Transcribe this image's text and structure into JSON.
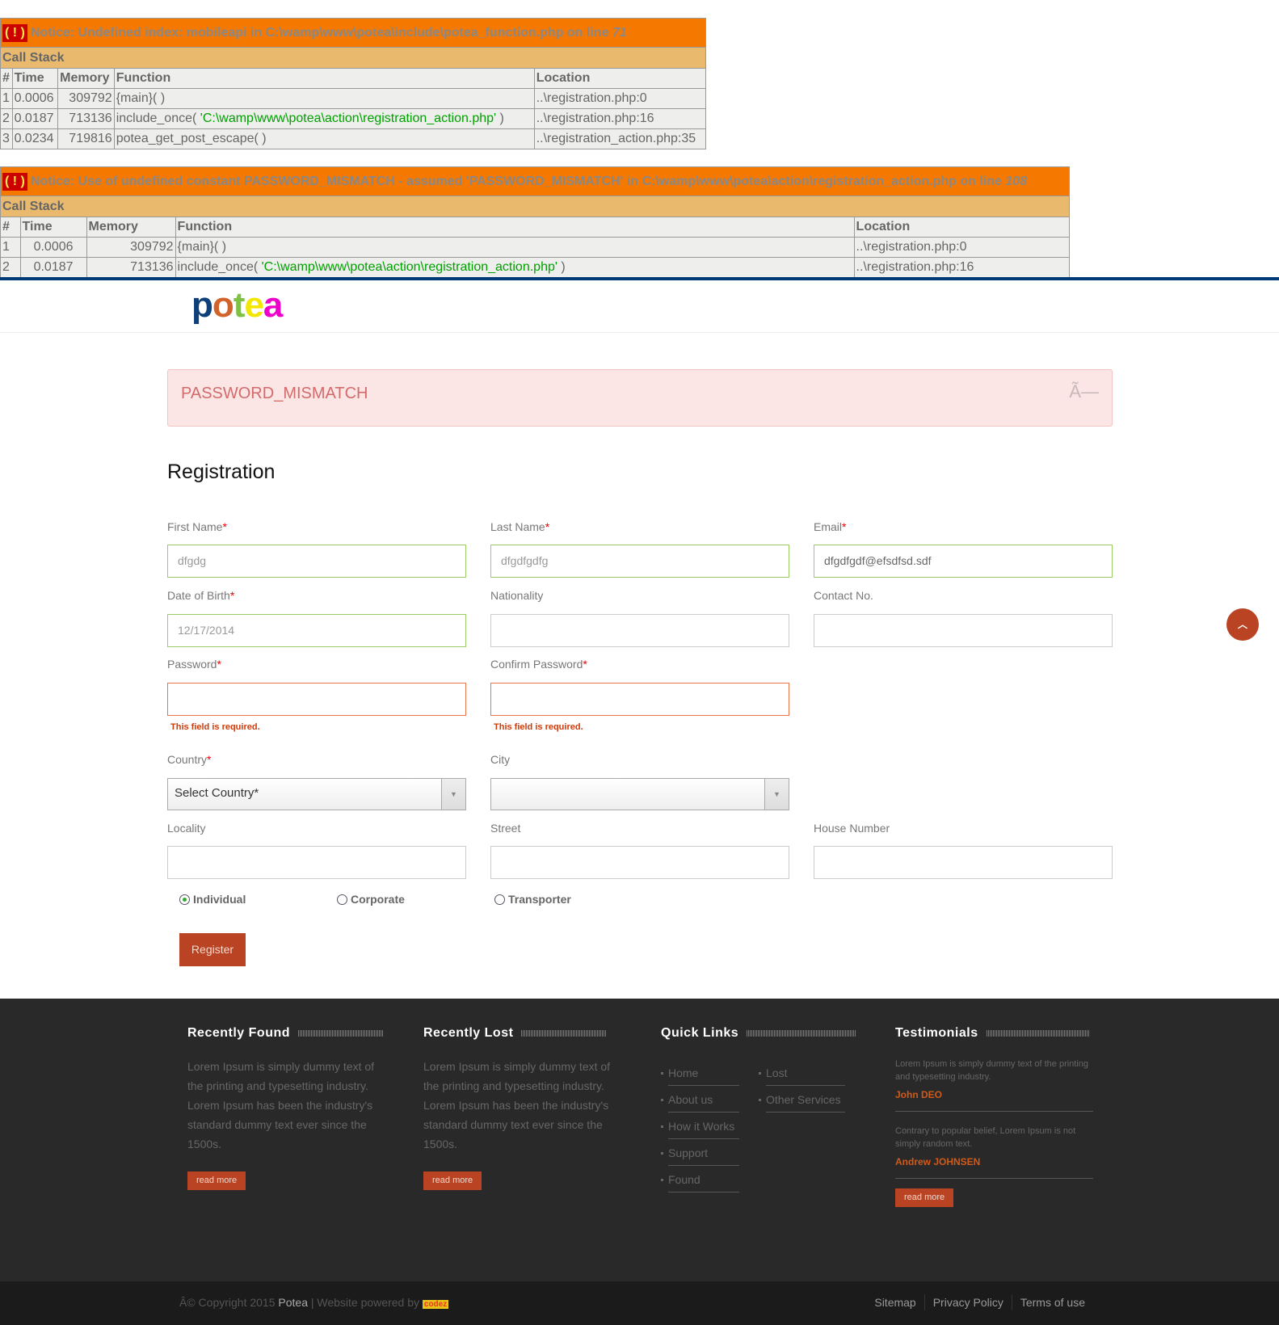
{
  "notices": [
    {
      "message": "Notice: Undefined index: mobileapi in C:\\wamp\\www\\potea\\include\\potea_function.php on line ",
      "line": "71",
      "bang": "( ! )",
      "call_stack_label": "Call Stack",
      "headers": [
        "#",
        "Time",
        "Memory",
        "Function",
        "Location"
      ],
      "rows": [
        {
          "n": "1",
          "time": "0.0006",
          "mem": "309792",
          "fn": "{main}( )",
          "arg": "",
          "fn_end": "",
          "loc": "..\\registration.php",
          "loc_line": "0"
        },
        {
          "n": "2",
          "time": "0.0187",
          "mem": "713136",
          "fn": "include_once( ",
          "arg": "'C:\\wamp\\www\\potea\\action\\registration_action.php'",
          "fn_end": " )",
          "loc": "..\\registration.php",
          "loc_line": "16"
        },
        {
          "n": "3",
          "time": "0.0234",
          "mem": "719816",
          "fn": "potea_get_post_escape( )",
          "arg": "",
          "fn_end": "",
          "loc": "..\\registration_action.php",
          "loc_line": "35"
        }
      ]
    },
    {
      "message": "Notice: Use of undefined constant PASSWORD_MISMATCH - assumed 'PASSWORD_MISMATCH' in C:\\wamp\\www\\potea\\action\\registration_action.php on line ",
      "line": "108",
      "bang": "( ! )",
      "call_stack_label": "Call Stack",
      "headers": [
        "#",
        "Time",
        "Memory",
        "Function",
        "Location"
      ],
      "rows": [
        {
          "n": "1",
          "time": "0.0006",
          "mem": "309792",
          "fn": "{main}( )",
          "arg": "",
          "fn_end": "",
          "loc": "..\\registration.php",
          "loc_line": "0"
        },
        {
          "n": "2",
          "time": "0.0187",
          "mem": "713136",
          "fn": "include_once( ",
          "arg": "'C:\\wamp\\www\\potea\\action\\registration_action.php'",
          "fn_end": " )",
          "loc": "..\\registration.php",
          "loc_line": "16"
        }
      ]
    }
  ],
  "logo": {
    "letters": [
      "p",
      "o",
      "t",
      "e",
      "a"
    ],
    "colors": [
      "#0d3f7a",
      "#d2632b",
      "#7dc242",
      "#f3e600",
      "#ee00c8"
    ]
  },
  "alert": {
    "text": "PASSWORD_MISMATCH",
    "close": "Ã—"
  },
  "form": {
    "title": "Registration",
    "required_mark": "*",
    "first_name": {
      "label": "First Name",
      "value": "dfgdg"
    },
    "last_name": {
      "label": "Last Name",
      "value": "dfgdfgdfg"
    },
    "email": {
      "label": "Email",
      "value": "dfgdfgdf@efsdfsd.sdf"
    },
    "dob": {
      "label": "Date of Birth",
      "value": "12/17/2014"
    },
    "nationality": {
      "label": "Nationality",
      "value": ""
    },
    "contact": {
      "label": "Contact No.",
      "value": ""
    },
    "password": {
      "label": "Password",
      "error": "This field is required."
    },
    "confirm_password": {
      "label": "Confirm Password",
      "error": "This field is required."
    },
    "country": {
      "label": "Country",
      "selected": "Select Country*"
    },
    "city": {
      "label": "City",
      "selected": ""
    },
    "locality": {
      "label": "Locality"
    },
    "street": {
      "label": "Street"
    },
    "house": {
      "label": "House Number"
    },
    "account_types": [
      {
        "label": "Individual",
        "checked": true
      },
      {
        "label": "Corporate",
        "checked": false
      },
      {
        "label": "Transporter",
        "checked": false
      }
    ],
    "submit": "Register"
  },
  "scroll_top_icon": "chevron-up-icon",
  "footer": {
    "recently_found": {
      "title": "Recently Found",
      "text": "Lorem Ipsum is simply dummy text of the printing and typesetting industry. Lorem Ipsum has been the industry's standard dummy text ever since the 1500s.",
      "button": "read more"
    },
    "recently_lost": {
      "title": "Recently Lost",
      "text": "Lorem Ipsum is simply dummy text of the printing and typesetting industry. Lorem Ipsum has been the industry's standard dummy text ever since the 1500s.",
      "button": "read more"
    },
    "quick_links": {
      "title": "Quick Links",
      "col1": [
        "Home",
        "About us",
        "How it Works",
        "Support",
        "Found"
      ],
      "col2": [
        "Lost",
        "Other Services"
      ]
    },
    "testimonials": {
      "title": "Testimonials",
      "items": [
        {
          "text": "Lorem Ipsum is simply dummy text of the printing and typesetting industry.",
          "author": "John DEO"
        },
        {
          "text": "Contrary to popular belief, Lorem Ipsum is not simply random text.",
          "author": "Andrew JOHNSEN"
        }
      ],
      "button": "read more"
    },
    "copyright_prefix": "Â© Copyright 2015 ",
    "brand": "Potea",
    "powered": " | Website powered by ",
    "powered_logo": "codez",
    "links": [
      "Sitemap",
      "Privacy Policy",
      "Terms of use"
    ]
  }
}
